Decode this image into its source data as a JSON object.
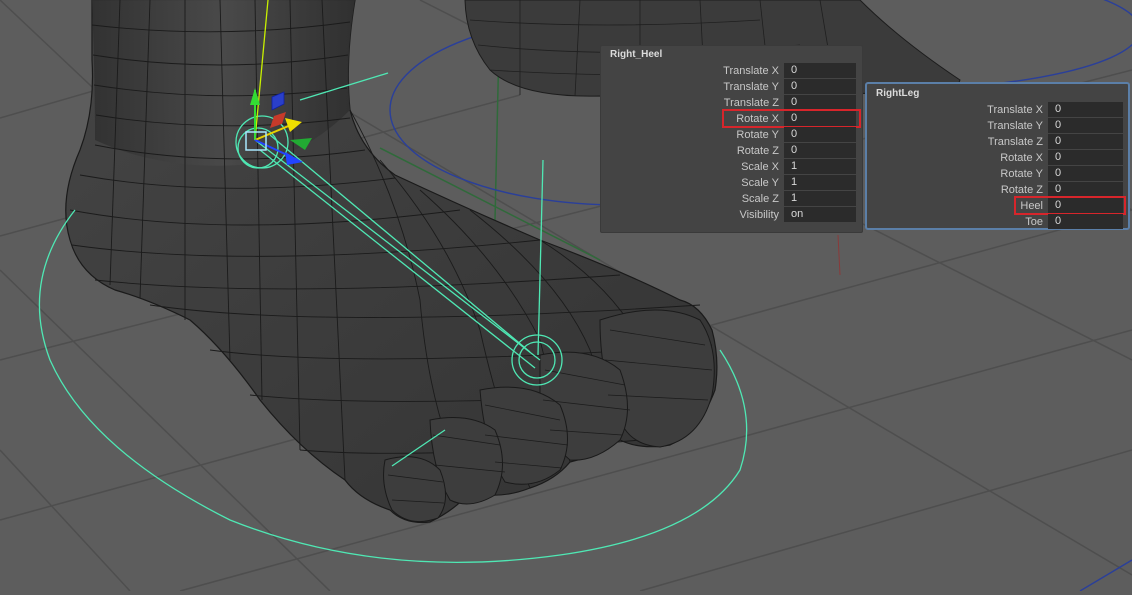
{
  "channel_boxes": [
    {
      "title": "Right_Heel",
      "rows": [
        {
          "label": "Translate X",
          "value": "0"
        },
        {
          "label": "Translate Y",
          "value": "0"
        },
        {
          "label": "Translate Z",
          "value": "0"
        },
        {
          "label": "Rotate X",
          "value": "0",
          "highlighted": true
        },
        {
          "label": "Rotate Y",
          "value": "0"
        },
        {
          "label": "Rotate Z",
          "value": "0"
        },
        {
          "label": "Scale X",
          "value": "1"
        },
        {
          "label": "Scale Y",
          "value": "1"
        },
        {
          "label": "Scale Z",
          "value": "1"
        },
        {
          "label": "Visibility",
          "value": "on"
        }
      ]
    },
    {
      "title": "RightLeg",
      "rows": [
        {
          "label": "Translate X",
          "value": "0"
        },
        {
          "label": "Translate Y",
          "value": "0"
        },
        {
          "label": "Translate Z",
          "value": "0"
        },
        {
          "label": "Rotate X",
          "value": "0"
        },
        {
          "label": "Rotate Y",
          "value": "0"
        },
        {
          "label": "Rotate Z",
          "value": "0"
        },
        {
          "label": "Heel",
          "value": "0",
          "highlighted": true
        },
        {
          "label": "Toe",
          "value": "0"
        }
      ]
    }
  ],
  "colors": {
    "viewport_bg": "#5d5d5d",
    "grid_line": "#4e4e4e",
    "mesh_fill": "#3c3c3c",
    "wireframe": "#1b1b1b",
    "control_curve": "#4fe8b4",
    "selection_highlight": "#d7252b",
    "panel_bg": "#444444",
    "field_bg": "#2b2b2b",
    "active_panel_border": "#5b7fa8"
  },
  "icons": [
    "move-manipulator-icon",
    "rotate-manipulator-icon"
  ]
}
